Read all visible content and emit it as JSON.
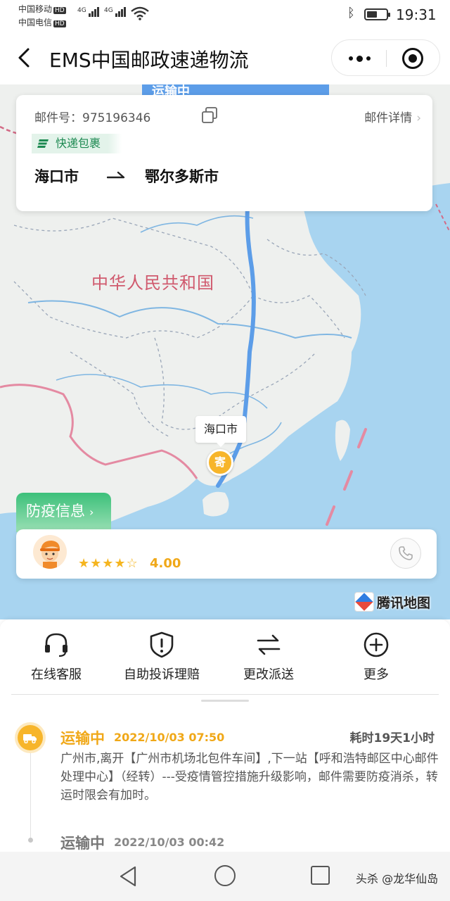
{
  "status_bar": {
    "carrier1": "中国移动",
    "carrier2": "中国电信",
    "hd": "HD",
    "net1": "4G",
    "net2": "4G",
    "time": "19:31"
  },
  "nav": {
    "title": "EMS中国邮政速递物流"
  },
  "map": {
    "status_ribbon": "运输中",
    "country_label": "中华人民共和国",
    "city_callout": "海口市",
    "marker_char": "寄",
    "brand": "腾讯地图"
  },
  "shipment": {
    "tracking_label": "邮件号：",
    "tracking_number": "975196346",
    "detail_link": "邮件详情",
    "package_type": "快递包裹",
    "origin": "海口市",
    "destination": "鄂尔多斯市"
  },
  "epidemic": {
    "label": "防疫信息"
  },
  "courier": {
    "rating_value": "4.00",
    "stars_filled": 4,
    "stars_total": 5
  },
  "actions": [
    {
      "label": "在线客服",
      "icon": "headset-icon"
    },
    {
      "label": "自助投诉理赔",
      "icon": "shield-alert-icon"
    },
    {
      "label": "更改派送",
      "icon": "swap-arrows-icon"
    },
    {
      "label": "更多",
      "icon": "plus-circle-icon"
    }
  ],
  "timeline": [
    {
      "status": "运输中",
      "time": "2022/10/03 07:50",
      "duration": "耗时19天1小时",
      "description": "广州市,离开【广州市机场北包件车间】,下一站【呼和浩特邮区中心邮件处理中心】（经转）---受疫情管控措施升级影响，邮件需要防疫消杀，转运时限会有加时。"
    },
    {
      "status": "运输中",
      "time": "2022/10/03 00:42"
    }
  ],
  "watermark": "头杀 @龙华仙岛",
  "colors": {
    "accent_orange": "#f0a818",
    "route_blue": "#5c9de8",
    "tag_green": "#1e8a52",
    "epidemic_green": "#3cc07a"
  }
}
